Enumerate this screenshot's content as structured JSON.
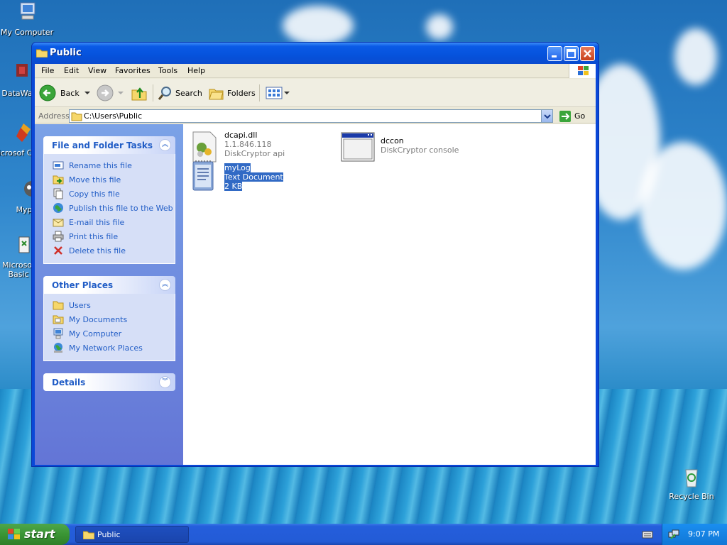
{
  "desktop": {
    "icons": [
      {
        "label": "My Computer"
      },
      {
        "label": "DataWa"
      },
      {
        "label": "Microsof C++"
      },
      {
        "label": "Myp"
      },
      {
        "label": "Microsof Basic"
      }
    ],
    "recycle_bin": "Recycle Bin"
  },
  "window": {
    "title": "Public",
    "menus": [
      "File",
      "Edit",
      "View",
      "Favorites",
      "Tools",
      "Help"
    ],
    "toolbar": {
      "back": "Back",
      "search": "Search",
      "folders": "Folders"
    },
    "address": {
      "label": "Address",
      "value": "C:\\Users\\Public",
      "go": "Go"
    },
    "tasks_panel": {
      "title": "File and Folder Tasks",
      "items": [
        {
          "label": "Rename this file",
          "icon": "rename-icon"
        },
        {
          "label": "Move this file",
          "icon": "move-icon"
        },
        {
          "label": "Copy this file",
          "icon": "copy-icon"
        },
        {
          "label": "Publish this file to the Web",
          "icon": "globe-icon"
        },
        {
          "label": "E-mail this file",
          "icon": "email-icon"
        },
        {
          "label": "Print this file",
          "icon": "print-icon"
        },
        {
          "label": "Delete this file",
          "icon": "delete-icon"
        }
      ]
    },
    "places_panel": {
      "title": "Other Places",
      "items": [
        {
          "label": "Users",
          "icon": "folder-icon"
        },
        {
          "label": "My Documents",
          "icon": "documents-icon"
        },
        {
          "label": "My Computer",
          "icon": "computer-icon"
        },
        {
          "label": "My Network Places",
          "icon": "network-icon"
        }
      ]
    },
    "details_panel": {
      "title": "Details"
    },
    "files": [
      {
        "name": "dcapi.dll",
        "line2": "1.1.846.118",
        "line3": "DiskCryptor api",
        "icon": "dll-icon"
      },
      {
        "name": "dccon",
        "line2": "DiskCryptor console",
        "icon": "console-icon"
      },
      {
        "name": "myLog",
        "line2": "Text Document",
        "line3": "2 KB",
        "icon": "text-document-icon",
        "selected": true
      }
    ]
  },
  "taskbar": {
    "start": "start",
    "task": "Public",
    "clock": "9:07 PM"
  }
}
